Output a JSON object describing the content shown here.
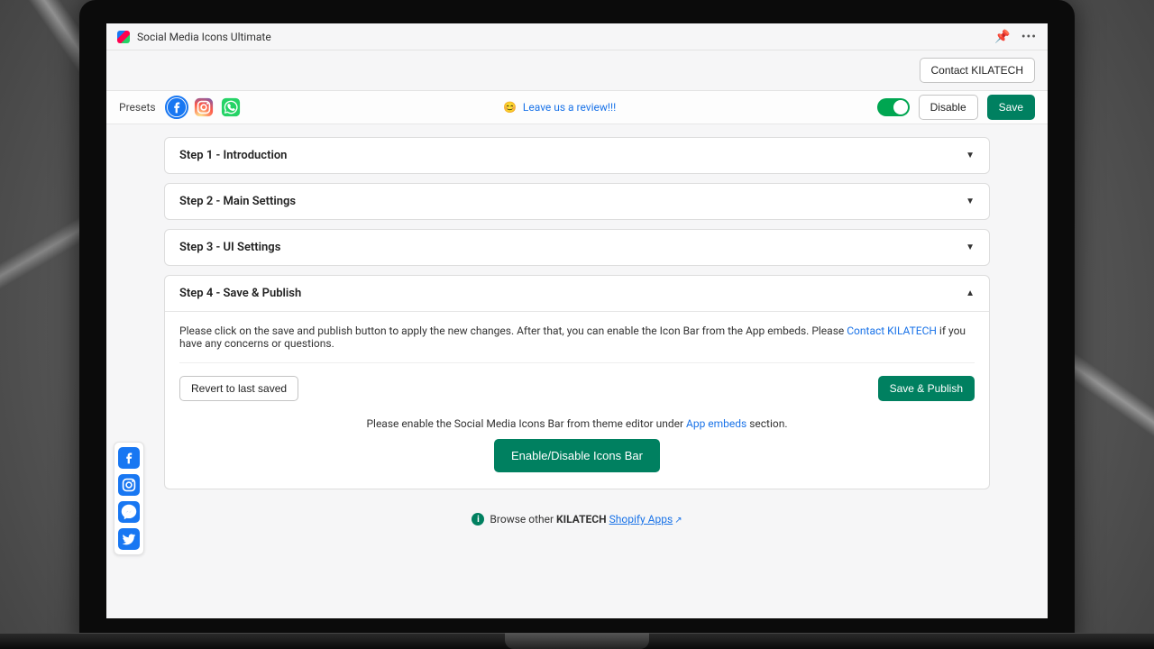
{
  "header": {
    "title": "Social Media Icons Ultimate"
  },
  "contact": {
    "button": "Contact KILATECH"
  },
  "toolbar": {
    "presets_label": "Presets",
    "review_text": "Leave us a review!!!",
    "disable_label": "Disable",
    "save_label": "Save"
  },
  "steps": [
    {
      "title": "Step 1 - Introduction"
    },
    {
      "title": "Step 2 - Main Settings"
    },
    {
      "title": "Step 3 - UI Settings"
    },
    {
      "title": "Step 4 - Save & Publish"
    }
  ],
  "step4": {
    "body_1": "Please click on the save and publish button to apply the new changes. After that, you can enable the Icon Bar from the App embeds. Please ",
    "contact_link": "Contact KILATECH",
    "body_2": " if you have any concerns or questions.",
    "revert_label": "Revert to last saved",
    "save_publish_label": "Save & Publish",
    "enable_intro": "Please enable the Social Media Icons Bar from theme editor under ",
    "app_embeds": "App embeds",
    "enable_outro": " section.",
    "enable_button": "Enable/Disable Icons Bar"
  },
  "footer": {
    "browse_pre": "Browse other ",
    "brand": "KILATECH",
    "link": "Shopify Apps"
  },
  "preset_icons": [
    "facebook-icon",
    "instagram-icon",
    "whatsapp-icon"
  ],
  "float_icons": [
    "facebook-icon",
    "instagram-icon",
    "messenger-icon",
    "twitter-icon"
  ],
  "colors": {
    "primary": "#008060",
    "accent_blue": "#1877f2",
    "toggle_on": "#00a651"
  }
}
